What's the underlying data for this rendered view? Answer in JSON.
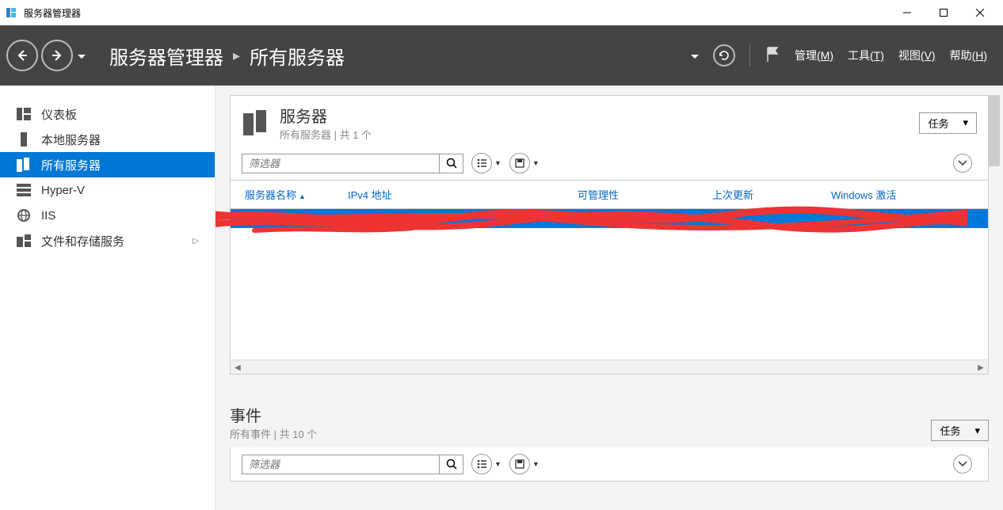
{
  "window": {
    "title": "服务器管理器"
  },
  "header": {
    "breadcrumb_root": "服务器管理器",
    "breadcrumb_current": "所有服务器",
    "menu": {
      "manage": "管理",
      "manage_key": "(M)",
      "tools": "工具",
      "tools_key": "(T)",
      "view": "视图",
      "view_key": "(V)",
      "help": "帮助",
      "help_key": "(H)"
    }
  },
  "sidebar": {
    "items": [
      {
        "label": "仪表板",
        "icon": "dashboard"
      },
      {
        "label": "本地服务器",
        "icon": "server"
      },
      {
        "label": "所有服务器",
        "icon": "servers"
      },
      {
        "label": "Hyper-V",
        "icon": "hyperv"
      },
      {
        "label": "IIS",
        "icon": "iis"
      },
      {
        "label": "文件和存储服务",
        "icon": "storage",
        "expandable": true
      }
    ]
  },
  "servers_panel": {
    "title": "服务器",
    "subtitle": "所有服务器 | 共 1 个",
    "tasks_label": "任务",
    "filter_placeholder": "筛选器",
    "columns": {
      "c1": "服务器名称",
      "c2": "IPv4 地址",
      "c3": "可管理性",
      "c4": "上次更新",
      "c5": "Windows 激活"
    }
  },
  "events_panel": {
    "title": "事件",
    "subtitle": "所有事件 | 共 10 个",
    "tasks_label": "任务",
    "filter_placeholder": "筛选器"
  }
}
